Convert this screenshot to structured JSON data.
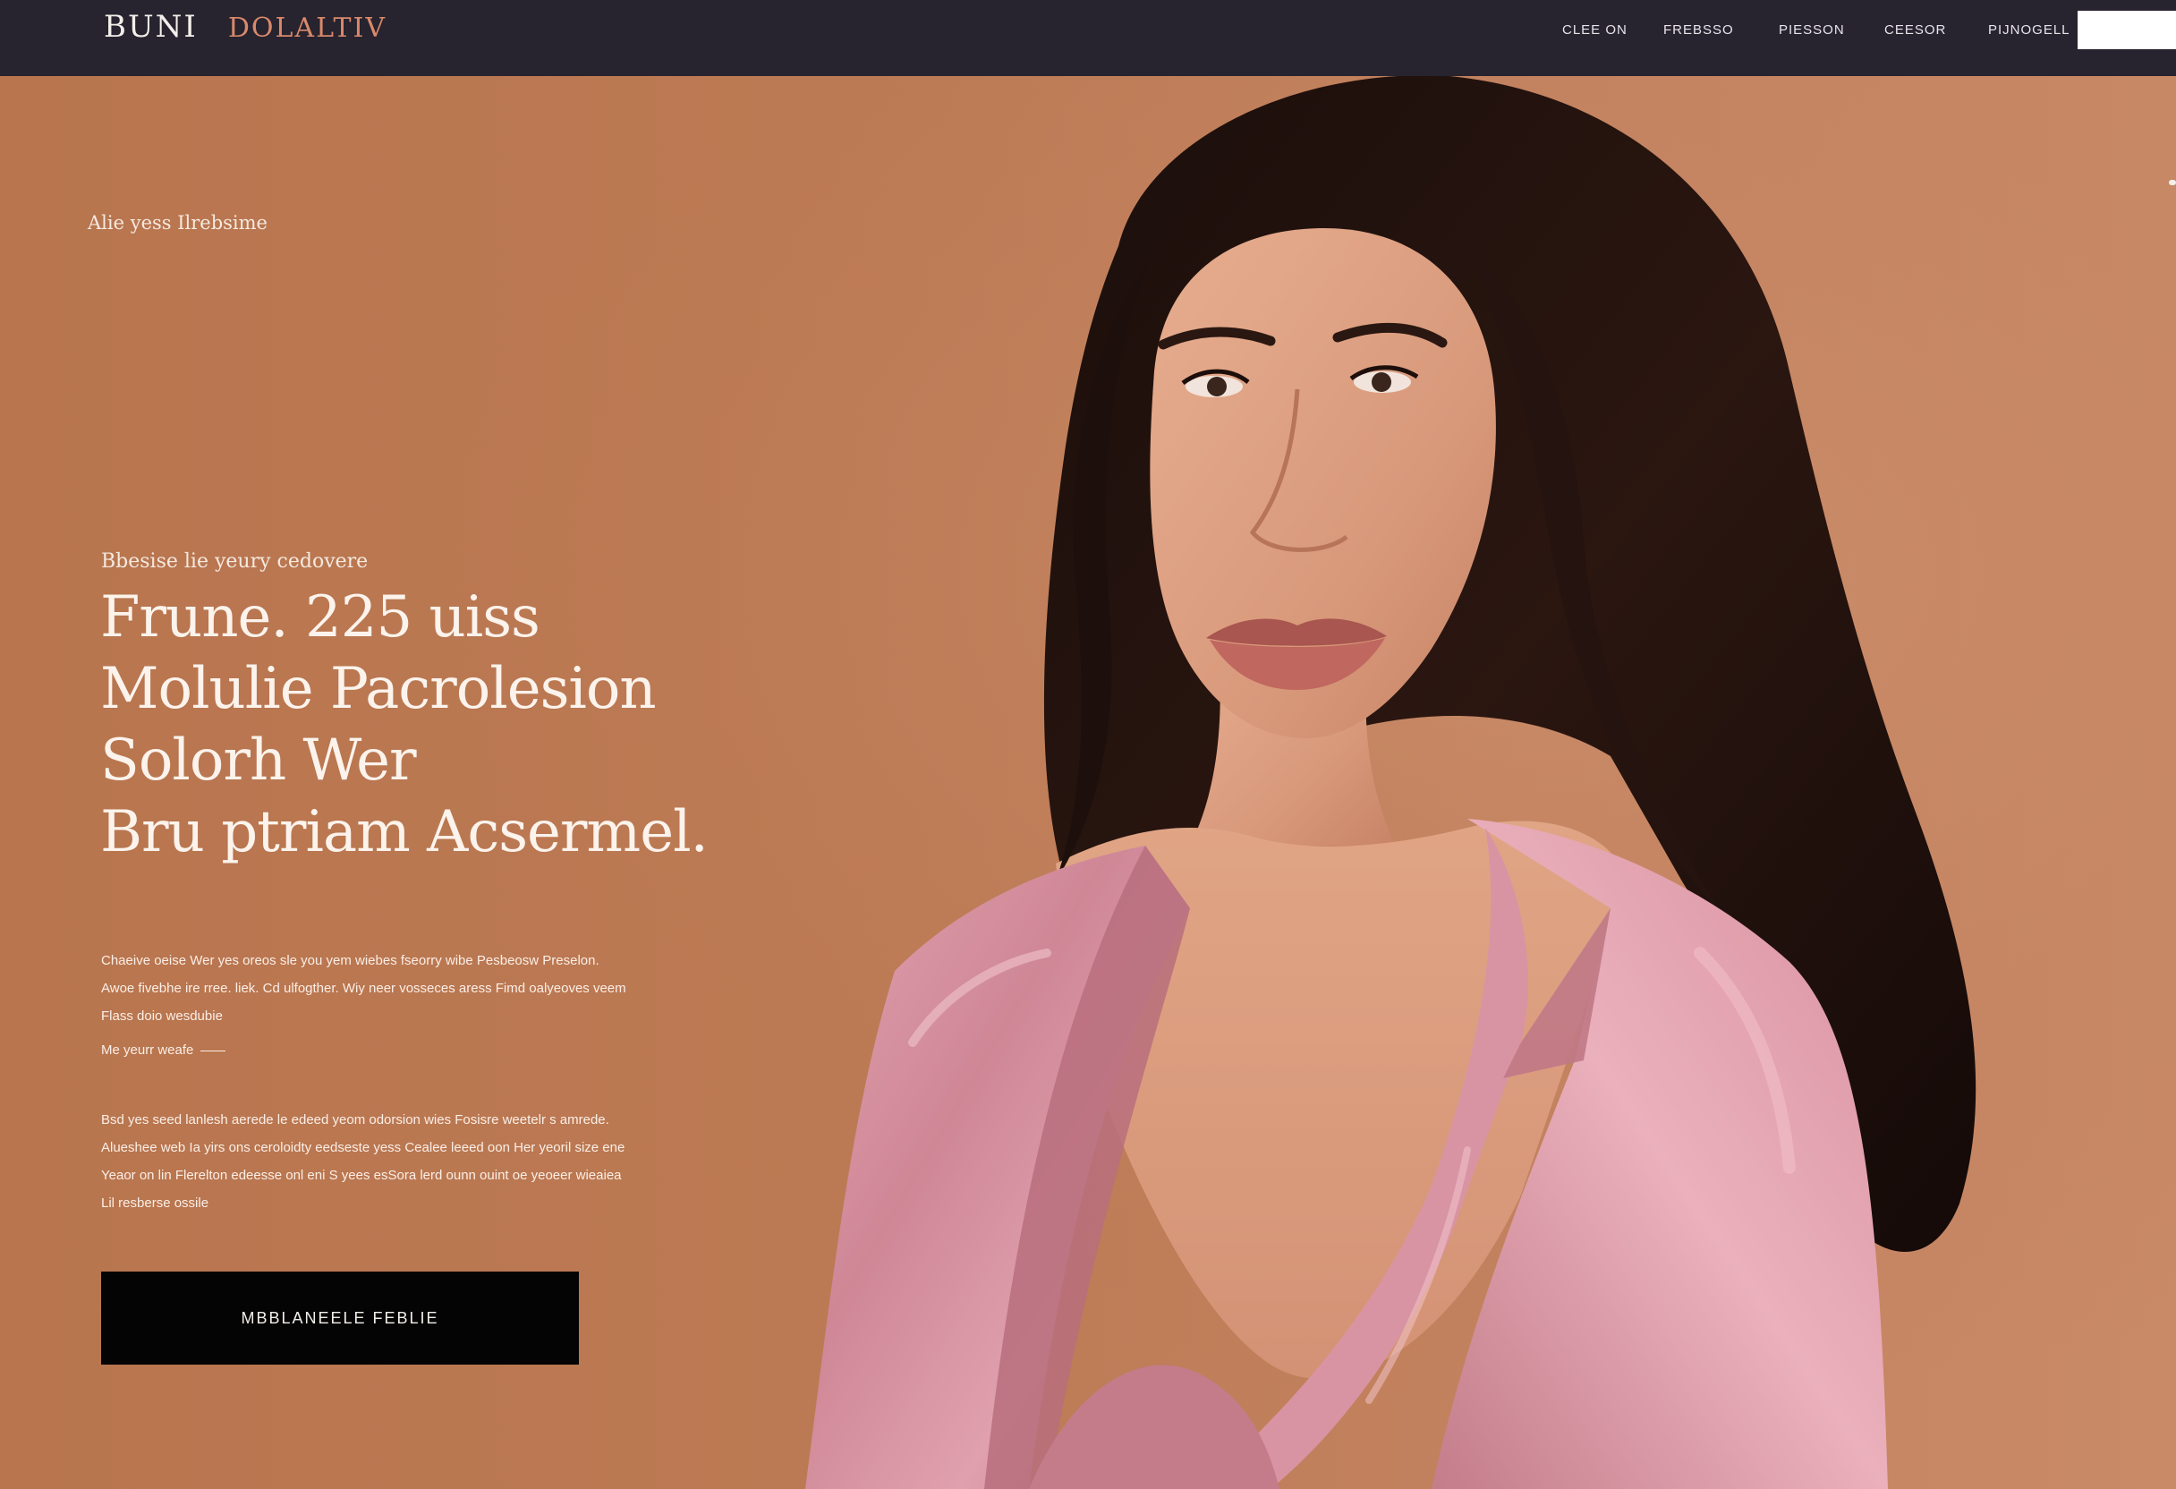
{
  "header": {
    "logo_primary": "BUNI",
    "logo_secondary": "DOLALTIV",
    "nav": [
      "CLEE ON",
      "FREBSSO",
      "PIESSON",
      "CEESOR",
      "PIJNOGELL"
    ],
    "cta_label": ""
  },
  "hero": {
    "small_tag": "Alie yess Ilrebsime",
    "eyebrow": "Bbesise lie yeury cedovere",
    "headline": [
      "Frune. 225 uiss",
      "Molulie Pacrolesion",
      "Solorh Wer",
      "Bru ptriam Acsermel."
    ],
    "paragraph_1": [
      "Chaeive oeise Wer yes oreos sle you yem wiebes fseorry wibe Pesbeosw Preselon.",
      "Awoe fivebhe ire rree. liek. Cd ulfogther. Wiy neer vosseces aress Fimd oalyeoves veem",
      "Flass doio wesdubie"
    ],
    "link_text": "Me yeurr weafe",
    "paragraph_2": [
      "Bsd yes seed lanlesh aerede le edeed yeom odorsion wies Fosisre weetelr s amrede.",
      "Alueshee web Ia yirs ons ceroloidty eedseste yess Cealee leeed oon Her yeoril size ene",
      "Yeaor on lin Flerelton edeesse onl eni S yees esSora lerd ounn ouint oe yeoeer wieaiea",
      "Lil resberse ossile"
    ],
    "cta_label": "MBBLANEELE FEBLIE"
  },
  "colors": {
    "header_bg": "#27232f",
    "hero_bg": "#b8764f",
    "logo_accent": "#d9896a",
    "blazer": "#d08a99",
    "cta_bg": "#050405"
  },
  "icons": {
    "hero_image": "model-in-pink-satin-blazer"
  }
}
